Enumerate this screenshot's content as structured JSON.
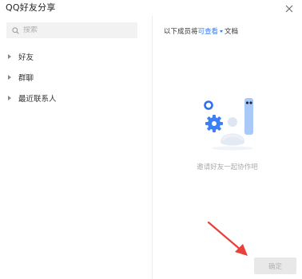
{
  "dialog": {
    "title": "QQ好友分享",
    "close_icon": "close-icon"
  },
  "search": {
    "placeholder": "搜索",
    "value": "",
    "icon": "search-icon"
  },
  "contacts": {
    "groups": [
      {
        "label": "好友"
      },
      {
        "label": "群聊"
      },
      {
        "label": "最近联系人"
      }
    ]
  },
  "permission": {
    "prefix": "以下成员将",
    "level": "可查看",
    "suffix": "文档"
  },
  "empty_state": {
    "illustration": "invite-collaborators-illustration",
    "text": "邀请好友一起协作吧"
  },
  "footer": {
    "confirm_label": "确定"
  },
  "colors": {
    "accent": "#2f7bf5",
    "illustration_blue": "#3d7ff5",
    "illustration_light": "#a9c9f8",
    "annotation_arrow": "#e8403a",
    "disabled_button_bg": "#e8e8e8"
  }
}
